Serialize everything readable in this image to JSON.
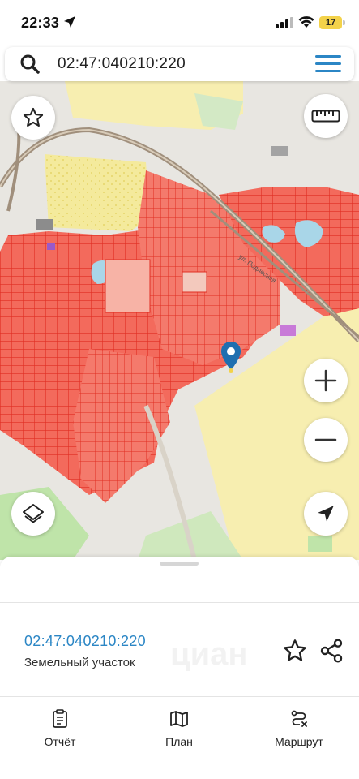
{
  "status_bar": {
    "time": "22:33",
    "battery": "17"
  },
  "search": {
    "query": "02:47:040210:220",
    "icon": "search-icon",
    "menu_icon": "menu-icon"
  },
  "map": {
    "controls": {
      "favorite": "star-icon",
      "ruler": "ruler-icon",
      "zoom_in": "plus-icon",
      "zoom_out": "minus-icon",
      "layers": "layers-icon",
      "locate": "navigation-arrow-icon"
    },
    "marker": "map-pin-icon",
    "colors": {
      "parcel_fill": "#f36a5c",
      "parcel_border": "#e02e22",
      "background": "#e8e6e1",
      "field": "#f7eeb0",
      "water": "#a9d6e8",
      "green": "#bfe4a9",
      "road": "#a08f7c"
    },
    "street_label": "ул. Подлесная"
  },
  "sheet": {
    "cadastral_number": "02:47:040210:220",
    "plot_type": "Земельный участок",
    "accent": "#2b86c5",
    "watermark": "циан"
  },
  "bottom_nav": [
    {
      "label": "Отчёт",
      "icon": "report-icon"
    },
    {
      "label": "План",
      "icon": "map-plan-icon"
    },
    {
      "label": "Маршрут",
      "icon": "route-icon"
    }
  ]
}
